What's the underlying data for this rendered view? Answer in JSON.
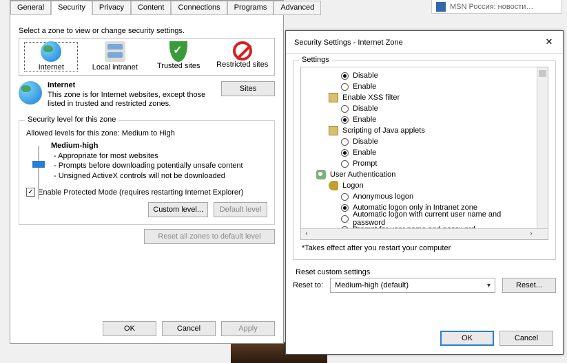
{
  "bg_tab_text": "MSN Россия: новости…",
  "iopt": {
    "tabs": [
      "General",
      "Security",
      "Privacy",
      "Content",
      "Connections",
      "Programs",
      "Advanced"
    ],
    "active_tab_index": 1,
    "zone_instruction": "Select a zone to view or change security settings.",
    "zones": [
      {
        "label": "Internet"
      },
      {
        "label": "Local intranet"
      },
      {
        "label": "Trusted sites"
      },
      {
        "label": "Restricted sites"
      }
    ],
    "active_zone_index": 0,
    "desc_title": "Internet",
    "desc_text": "This zone is for Internet websites, except those listed in trusted and restricted zones.",
    "sites_btn": "Sites",
    "group_label": "Security level for this zone",
    "allowed": "Allowed levels for this zone: Medium to High",
    "level_name": "Medium-high",
    "level_bullets": [
      "- Appropriate for most websites",
      "- Prompts before downloading potentially unsafe content",
      "- Unsigned ActiveX controls will not be downloaded"
    ],
    "prot_checked": true,
    "prot_label": "Enable Protected Mode (requires restarting Internet Explorer)",
    "custom_btn": "Custom level...",
    "default_btn": "Default level",
    "resetall_btn": "Reset all zones to default level",
    "ok": "OK",
    "cancel": "Cancel",
    "apply": "Apply"
  },
  "secset": {
    "title": "Security Settings - Internet Zone",
    "group_label": "Settings",
    "tree": [
      {
        "type": "radio",
        "indent": 2,
        "label": "Disable",
        "sel": true
      },
      {
        "type": "radio",
        "indent": 2,
        "label": "Enable",
        "sel": false
      },
      {
        "type": "cat",
        "indent": 1,
        "icon": "page",
        "label": "Enable XSS filter"
      },
      {
        "type": "radio",
        "indent": 2,
        "label": "Disable",
        "sel": false
      },
      {
        "type": "radio",
        "indent": 2,
        "label": "Enable",
        "sel": true
      },
      {
        "type": "cat",
        "indent": 1,
        "icon": "page",
        "label": "Scripting of Java applets"
      },
      {
        "type": "radio",
        "indent": 2,
        "label": "Disable",
        "sel": false
      },
      {
        "type": "radio",
        "indent": 2,
        "label": "Enable",
        "sel": true
      },
      {
        "type": "radio",
        "indent": 2,
        "label": "Prompt",
        "sel": false
      },
      {
        "type": "cat",
        "indent": 0,
        "icon": "users",
        "label": "User Authentication"
      },
      {
        "type": "cat",
        "indent": 1,
        "icon": "key",
        "label": "Logon"
      },
      {
        "type": "radio",
        "indent": 2,
        "label": "Anonymous logon",
        "sel": false
      },
      {
        "type": "radio",
        "indent": 2,
        "label": "Automatic logon only in Intranet zone",
        "sel": true
      },
      {
        "type": "radio",
        "indent": 2,
        "label": "Automatic logon with current user name and password",
        "sel": false
      },
      {
        "type": "radio",
        "indent": 2,
        "label": "Prompt for user name and password",
        "sel": false
      }
    ],
    "note": "*Takes effect after you restart your computer",
    "reset_label": "Reset custom settings",
    "reset_to": "Reset to:",
    "combo_value": "Medium-high (default)",
    "reset_btn": "Reset...",
    "ok": "OK",
    "cancel": "Cancel"
  }
}
